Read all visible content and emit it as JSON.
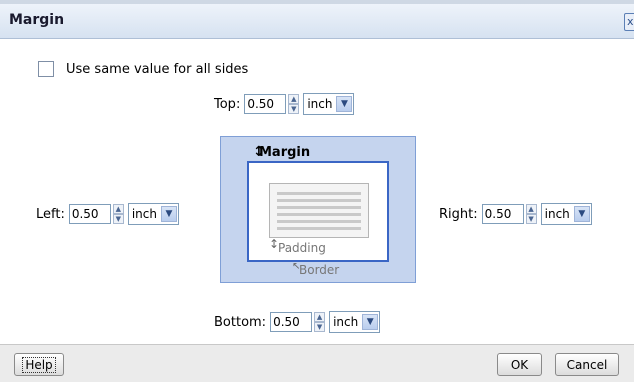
{
  "dialog": {
    "title": "Margin",
    "close_glyph": "x",
    "same_value_label": "Use same value for all sides",
    "same_value_checked": false
  },
  "fields": {
    "top": {
      "label": "Top:",
      "value": "0.50",
      "unit": "inch"
    },
    "left": {
      "label": "Left:",
      "value": "0.50",
      "unit": "inch"
    },
    "right": {
      "label": "Right:",
      "value": "0.50",
      "unit": "inch"
    },
    "bottom": {
      "label": "Bottom:",
      "value": "0.50",
      "unit": "inch"
    }
  },
  "diagram": {
    "margin_label": "Margin",
    "padding_label": "Padding",
    "border_label": "Border"
  },
  "footer": {
    "help_label": "Help",
    "ok_label": "OK",
    "cancel_label": "Cancel"
  },
  "icons": {
    "spinner_up": "chevron-up-icon",
    "spinner_down": "chevron-down-icon",
    "dropdown": "dropdown-arrow-icon",
    "margin_arrow": "vertical-double-arrow-icon"
  },
  "colors": {
    "titlebar": "#d6e2f1",
    "diagram_margin": "#c5d4ee",
    "diagram_border": "#3a66c5"
  }
}
